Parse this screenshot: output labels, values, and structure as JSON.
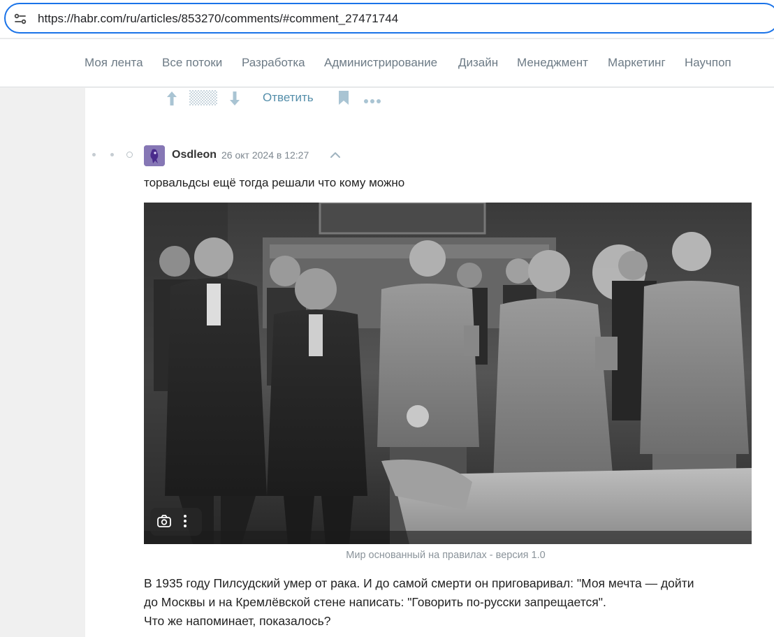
{
  "browser": {
    "url": "https://habr.com/ru/articles/853270/comments/#comment_27471744",
    "site_info_icon": "tune-icon"
  },
  "nav": {
    "items": [
      "Моя лента",
      "Все потоки",
      "Разработка",
      "Администрирование",
      "Дизайн",
      "Менеджмент",
      "Маркетинг",
      "Научпоп"
    ]
  },
  "prev_comment_actions": {
    "upvote_icon": "arrow-up-icon",
    "score_icon": "hidden-score-icon",
    "downvote_icon": "arrow-down-icon",
    "reply_label": "Ответить",
    "bookmark_icon": "bookmark-icon",
    "more_icon": "more-horizontal-icon"
  },
  "comment": {
    "username": "Osdleon",
    "timestamp": "26 окт 2024 в 12:27",
    "text": "торвальдсы ещё тогда решали что кому можно",
    "image": {
      "alt": "Черно-белая фотография группы мужчин в костюмах и военной форме",
      "lens_icon": "camera-search-icon",
      "menu_icon": "more-vertical-icon"
    },
    "caption": "Мир основанный на правилах - версия 1.0",
    "paragraphs": [
      "В 1935 году Пилсудский умер от рака. И до самой смерти он приговаривал: \"Моя мечта — дойти",
      "до Москвы и на Кремлёвской стене написать: \"Говорить по-русски запрещается\".",
      "Что же напоминает, показалось?"
    ]
  },
  "colors": {
    "accent_link": "#548eaa",
    "nav_text": "#6c7a85",
    "url_border": "#1a73e8"
  }
}
